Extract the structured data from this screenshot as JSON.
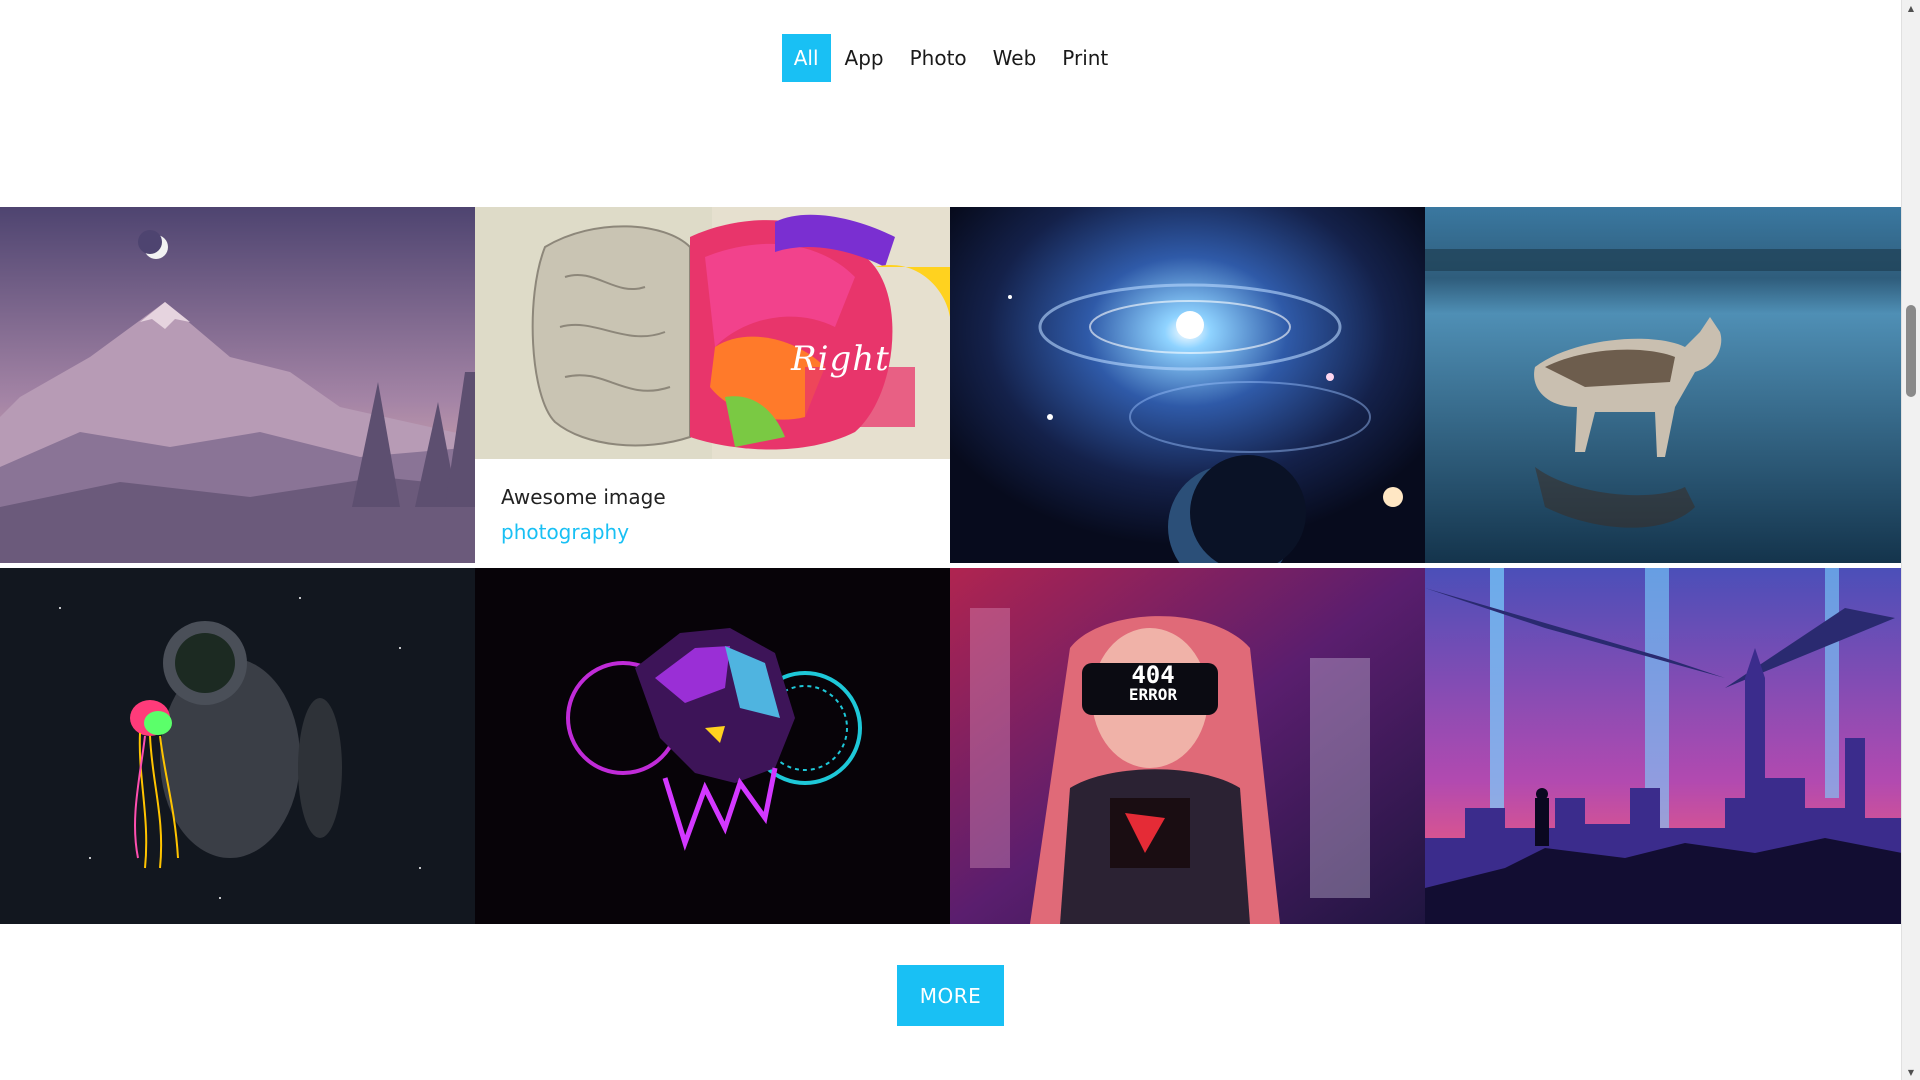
{
  "filters": [
    {
      "label": "All",
      "active": true
    },
    {
      "label": "App",
      "active": false
    },
    {
      "label": "Photo",
      "active": false
    },
    {
      "label": "Web",
      "active": false
    },
    {
      "label": "Print",
      "active": false
    }
  ],
  "gallery": {
    "tiles": [
      {
        "subject": "mountain-moon-landscape"
      },
      {
        "subject": "brain-left-right-art",
        "hover": true,
        "art_text": "Right",
        "caption_title": "Awesome image",
        "caption_tag": "photography"
      },
      {
        "subject": "galaxy-space"
      },
      {
        "subject": "husky-on-lake"
      },
      {
        "subject": "astronaut-jellyfish"
      },
      {
        "subject": "neon-panther"
      },
      {
        "subject": "cyberpunk-404-error-girl",
        "art_text_1": "404",
        "art_text_2": "ERROR"
      },
      {
        "subject": "neon-city-skyline"
      }
    ]
  },
  "more_button": {
    "label": "MORE"
  },
  "colors": {
    "accent": "#19c0f4",
    "background": "#ffffff"
  }
}
